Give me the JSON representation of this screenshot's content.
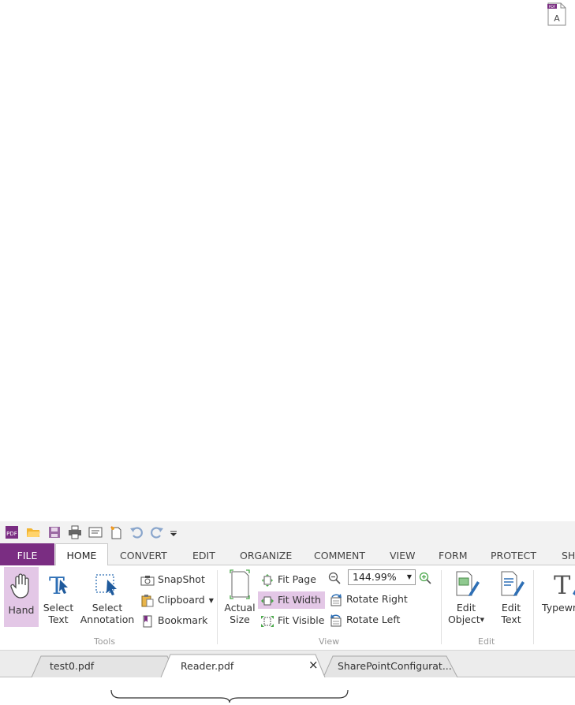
{
  "quick_access": {
    "icons": [
      "pdf-logo-icon",
      "open-folder-icon",
      "save-icon",
      "print-icon",
      "properties-icon",
      "new-icon",
      "undo-icon",
      "redo-icon",
      "customize-dropdown-icon"
    ]
  },
  "ribbon_tabs": [
    "FILE",
    "HOME",
    "CONVERT",
    "EDIT",
    "ORGANIZE",
    "COMMENT",
    "VIEW",
    "FORM",
    "PROTECT",
    "SH"
  ],
  "tools": {
    "hand": "Hand",
    "select_text_1": "Select",
    "select_text_2": "Text",
    "select_annotation_1": "Select",
    "select_annotation_2": "Annotation",
    "snapshot": "SnapShot",
    "clipboard": "Clipboard",
    "bookmark": "Bookmark",
    "group_label": "Tools"
  },
  "view": {
    "actual_size_1": "Actual",
    "actual_size_2": "Size",
    "fit_page": "Fit Page",
    "fit_width": "Fit Width",
    "fit_visible": "Fit Visible",
    "zoom_value": "144.99%",
    "rotate_right": "Rotate Right",
    "rotate_left": "Rotate Left",
    "group_label": "View"
  },
  "edit": {
    "edit_object_1": "Edit",
    "edit_object_2": "Object",
    "edit_text_1": "Edit",
    "edit_text_2": "Text",
    "group_label": "Edit"
  },
  "typewriter": {
    "label": "Typewr"
  },
  "document_tabs": [
    {
      "label": "test0.pdf"
    },
    {
      "label": "Reader.pdf",
      "close": "×"
    },
    {
      "label": "SharePointConfigurat..."
    }
  ],
  "colors": {
    "accent": "#7a2d82",
    "highlight": "#e3c7e6",
    "icon_blue": "#2e6fb5"
  }
}
